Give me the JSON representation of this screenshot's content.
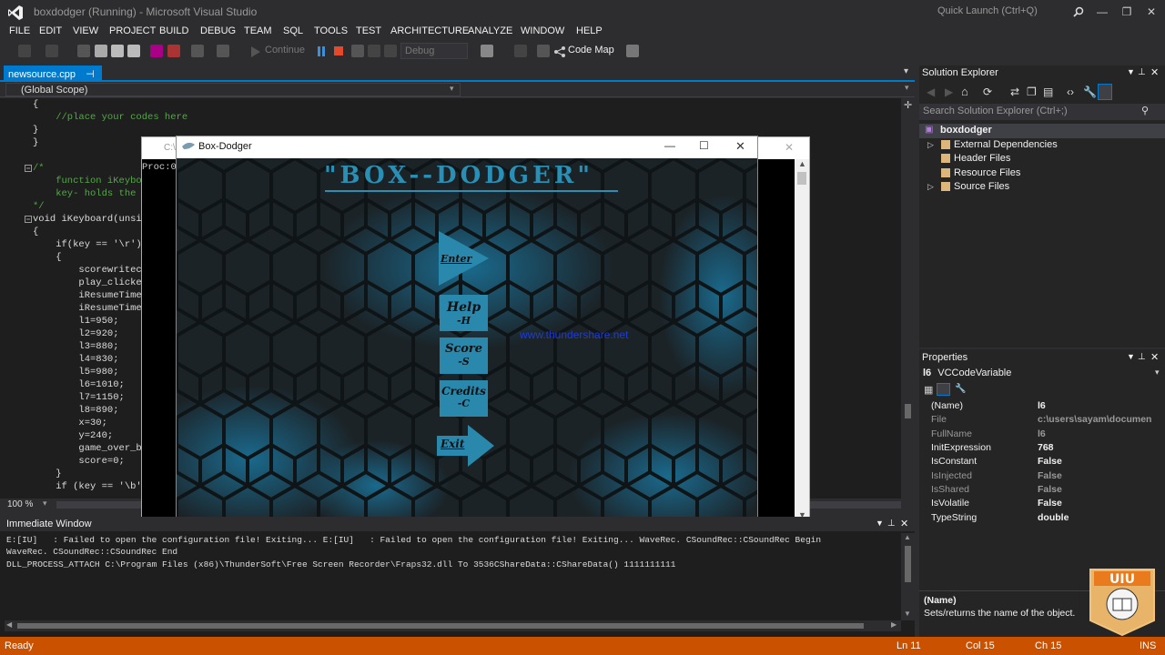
{
  "window": {
    "title": "boxdodger (Running) - Microsoft Visual Studio",
    "quick_launch_placeholder": "Quick Launch (Ctrl+Q)",
    "minimize": "—",
    "maximize": "❐",
    "close": "✕"
  },
  "menu": [
    "FILE",
    "EDIT",
    "VIEW",
    "PROJECT",
    "BUILD",
    "DEBUG",
    "TEAM",
    "SQL",
    "TOOLS",
    "TEST",
    "ARCHITECTURE",
    "ANALYZE",
    "WINDOW",
    "HELP"
  ],
  "toolbar": {
    "continue_label": "Continue",
    "config_value": "Debug",
    "code_map_label": "Code Map"
  },
  "editor": {
    "tab_label": "newsource.cpp",
    "scope": "(Global Scope)",
    "zoom": "100 %",
    "lines": [
      "{",
      "    //place your codes here",
      "}",
      "}",
      "/*",
      "    function iKeyboa",
      "    key- holds the A",
      "*/",
      "void iKeyboard(unsig",
      "{",
      "    if(key == '\\r')",
      "    {",
      "        scorewritecl",
      "        play_clicked",
      "        iResumeTimer",
      "        iResumeTimer",
      "        l1=950;",
      "        l2=920;",
      "        l3=880;",
      "        l4=830;",
      "        l5=980;",
      "        l6=1010;",
      "        l7=1150;",
      "        l8=890;",
      "        x=30;",
      "        y=240;",
      "        game_over_bm",
      "        score=0;",
      "    }",
      "    if (key == '\\b')"
    ]
  },
  "console": {
    "title": "C:\\",
    "text": "Proc:0"
  },
  "game": {
    "window_title": "Box-Dodger",
    "title": "\"BOX--DODGER\"",
    "enter": "Enter",
    "help": "Help",
    "help_key": "-H",
    "score": "Score",
    "score_key": "-S",
    "credits": "Credits",
    "credits_key": "-C",
    "exit": "Exit",
    "watermark": "www.thundershare.net"
  },
  "solution_explorer": {
    "title": "Solution Explorer",
    "search_placeholder": "Search Solution Explorer (Ctrl+;)",
    "project": "boxdodger",
    "items": [
      "External Dependencies",
      "Header Files",
      "Resource Files",
      "Source Files"
    ]
  },
  "properties": {
    "title": "Properties",
    "object": "l6",
    "object_type": "VCCodeVariable",
    "rows": [
      {
        "name": "(Name)",
        "value": "l6"
      },
      {
        "name": "File",
        "value": "c:\\users\\sayam\\documents\\v"
      },
      {
        "name": "FullName",
        "value": "l6"
      },
      {
        "name": "InitExpression",
        "value": "768"
      },
      {
        "name": "IsConstant",
        "value": "False"
      },
      {
        "name": "IsInjected",
        "value": "False"
      },
      {
        "name": "IsShared",
        "value": "False"
      },
      {
        "name": "IsVolatile",
        "value": "False"
      },
      {
        "name": "TypeString",
        "value": "double"
      }
    ],
    "desc_title": "(Name)",
    "desc_text": "Sets/returns the name of the object."
  },
  "immediate": {
    "title": "Immediate Window",
    "text": "E:[IU]   : Failed to open the configuration file! Exiting... E:[IU]   : Failed to open the configuration file! Exiting... WaveRec. CSoundRec::CSoundRec Begin\nWaveRec. CSoundRec::CSoundRec End\nDLL_PROCESS_ATTACH C:\\Program Files (x86)\\ThunderSoft\\Free Screen Recorder\\Fraps32.dll To 3536CShareData::CShareData() 1111111111"
  },
  "status": {
    "ready": "Ready",
    "line": "Ln 11",
    "col": "Col 15",
    "ch": "Ch 15",
    "ins": "INS"
  },
  "logo": {
    "text": "UIU",
    "sub": "UNITED INTERNATIONAL UNIVERSITY"
  },
  "colors": {
    "accent": "#007acc",
    "status": "#ca5100"
  }
}
